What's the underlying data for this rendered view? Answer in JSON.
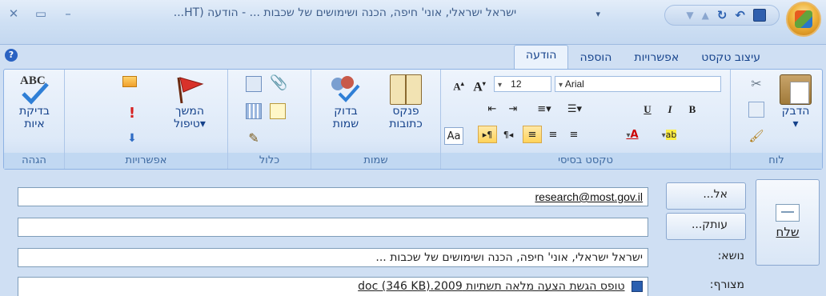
{
  "window": {
    "title": "ישראל ישראלי, אוני' חיפה, הכנה ושימושים של שכבות ... - הודעה (HT...",
    "minimize": "–",
    "maximize": "▭",
    "close": "✕"
  },
  "qat": {
    "save": "💾",
    "undo": "↶",
    "redo": "↻",
    "up": "▲",
    "down": "▼",
    "dropdown": "▾"
  },
  "tabs": [
    {
      "label": "הודעה",
      "active": true
    },
    {
      "label": "הוספה",
      "active": false
    },
    {
      "label": "אפשרויות",
      "active": false
    },
    {
      "label": "עיצוב טקסט",
      "active": false
    }
  ],
  "help": "?",
  "ribbon": {
    "clipboard": {
      "label": "לוח",
      "paste": "הדבק",
      "paste_arrow": "▾"
    },
    "basic_text": {
      "label": "טקסט בסיסי",
      "font_name": "Arial",
      "font_size": "12",
      "grow": "A",
      "shrink": "A",
      "bold": "B",
      "italic": "I",
      "underline": "U",
      "font_color": "A",
      "highlight": "ab"
    },
    "names": {
      "label": "שמות",
      "address_book_l1": "פנקס",
      "address_book_l2": "כתובות",
      "check_names_l1": "בדוק",
      "check_names_l2": "שמות"
    },
    "include": {
      "label": "כלול"
    },
    "options": {
      "label": "אפשרויות",
      "followup_l1": "המשך",
      "followup_l2": "טיפול",
      "arrow": "▾"
    },
    "proofing": {
      "label": "הגהה",
      "spelling_l1": "בדיקת",
      "spelling_l2": "איות",
      "abc": "ABC"
    }
  },
  "form": {
    "to_button": "אל...",
    "cc_button": "עותק...",
    "subject_label": "נושא:",
    "attachment_label": "מצורף:",
    "to_value": "research@most.gov.il",
    "cc_value": "",
    "subject_value": "ישראל ישראלי, אוני' חיפה, הכנה ושימושים של שכבות ...",
    "attachment_value": "טופס הגשת הצעה מלאה תשתיות 2009.doc (346 KB)",
    "send": "שלח"
  }
}
